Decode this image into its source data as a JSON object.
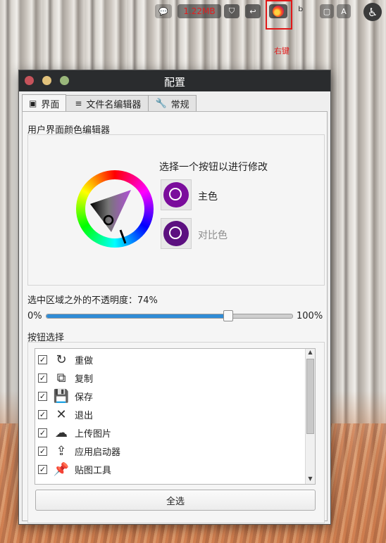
{
  "tray": {
    "speed": "1.22MB",
    "highlight_label": "右键"
  },
  "window": {
    "title": "配置",
    "tabs": [
      {
        "label": "界面",
        "icon": "interface-icon"
      },
      {
        "label": "文件名编辑器",
        "icon": "filename-editor-icon"
      },
      {
        "label": "常规",
        "icon": "wrench-icon"
      }
    ]
  },
  "ui_colors": {
    "section_title": "用户界面颜色编辑器",
    "prompt": "选择一个按钮以进行修改",
    "main_color_label": "主色",
    "contrast_color_label": "对比色",
    "main_color": "#7b0d9c",
    "contrast_color": "#5c1080"
  },
  "opacity": {
    "label": "选中区域之外的不透明度：",
    "value_text": "74%",
    "value": 0.74,
    "min_label": "0%",
    "max_label": "100%"
  },
  "buttons_section": {
    "title": "按钮选择",
    "items": [
      {
        "label": "重做",
        "checked": true,
        "icon": "redo-icon"
      },
      {
        "label": "复制",
        "checked": true,
        "icon": "copy-icon"
      },
      {
        "label": "保存",
        "checked": true,
        "icon": "save-icon"
      },
      {
        "label": "退出",
        "checked": true,
        "icon": "close-icon"
      },
      {
        "label": "上传图片",
        "checked": true,
        "icon": "upload-icon"
      },
      {
        "label": "应用启动器",
        "checked": true,
        "icon": "app-launcher-icon"
      },
      {
        "label": "贴图工具",
        "checked": true,
        "icon": "pin-icon"
      }
    ],
    "select_all_label": "全选"
  }
}
